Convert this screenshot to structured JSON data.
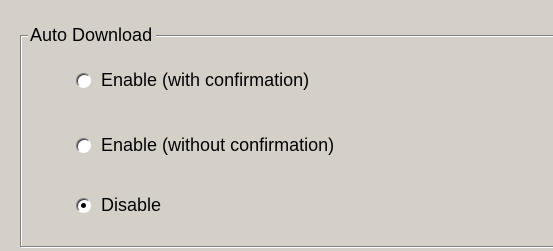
{
  "group": {
    "title": "Auto Download",
    "options": [
      {
        "label": "Enable (with confirmation)",
        "checked": false
      },
      {
        "label": "Enable (without confirmation)",
        "checked": false
      },
      {
        "label": "Disable",
        "checked": true
      }
    ]
  },
  "colors": {
    "face": "#d4d0c8",
    "shadow": "#808080",
    "highlight": "#ffffff"
  }
}
